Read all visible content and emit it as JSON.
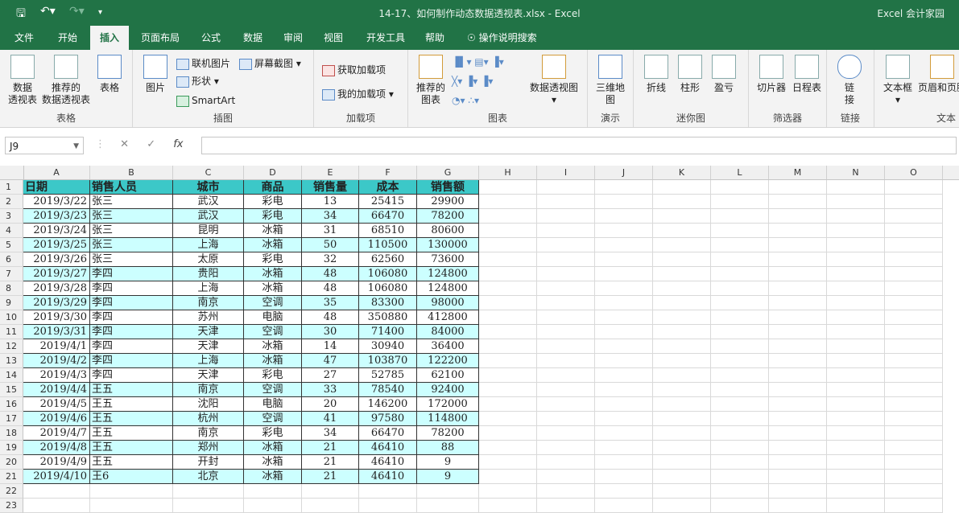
{
  "window": {
    "title": "14-17、如何制作动态数据透视表.xlsx  -  Excel",
    "account": "Excel 会计家园"
  },
  "tabs": [
    "文件",
    "开始",
    "插入",
    "页面布局",
    "公式",
    "数据",
    "审阅",
    "视图",
    "开发工具",
    "帮助"
  ],
  "tell_me": "操作说明搜索",
  "ribbon": {
    "groups": {
      "tables": "表格",
      "illustrations": "插图",
      "addins": "加载项",
      "charts": "图表",
      "tours": "演示",
      "sparklines": "迷你图",
      "filters": "筛选器",
      "links": "链接",
      "text": "文本"
    },
    "buttons": {
      "pivot1": "数据",
      "pivot2": "透视表",
      "rec_pivot1": "推荐的",
      "rec_pivot2": "数据透视表",
      "table": "表格",
      "picture": "图片",
      "online_pic": "联机图片",
      "shapes": "形状",
      "smartart": "SmartArt",
      "screenshot": "屏幕截图",
      "get_addins": "获取加载项",
      "my_addins": "我的加载项",
      "rec_chart1": "推荐的",
      "rec_chart2": "图表",
      "pivot_chart": "数据透视图",
      "map1": "三维地",
      "map2": "图",
      "spark_line": "折线",
      "spark_col": "柱形",
      "spark_wl": "盈亏",
      "slicer": "切片器",
      "timeline": "日程表",
      "link1": "链",
      "link2": "接",
      "textbox": "文本框",
      "header_footer": "页眉和页脚"
    }
  },
  "formula_bar": {
    "name_box": "J9",
    "fx": "fx",
    "value": ""
  },
  "columns": [
    "A",
    "B",
    "C",
    "D",
    "E",
    "F",
    "G",
    "H",
    "I",
    "J",
    "K",
    "L",
    "M",
    "N",
    "O"
  ],
  "row_numbers": [
    "1",
    "2",
    "3",
    "4",
    "5",
    "6",
    "7",
    "8",
    "9",
    "10",
    "11",
    "12",
    "13",
    "14",
    "15",
    "16",
    "17",
    "18",
    "19",
    "20",
    "21",
    "22",
    "23"
  ],
  "table": {
    "headers": [
      "日期",
      "销售人员",
      "城市",
      "商品",
      "销售量",
      "成本",
      "销售额"
    ],
    "rows": [
      [
        "2019/3/22",
        "张三",
        "武汉",
        "彩电",
        "13",
        "25415",
        "29900"
      ],
      [
        "2019/3/23",
        "张三",
        "武汉",
        "彩电",
        "34",
        "66470",
        "78200"
      ],
      [
        "2019/3/24",
        "张三",
        "昆明",
        "冰箱",
        "31",
        "68510",
        "80600"
      ],
      [
        "2019/3/25",
        "张三",
        "上海",
        "冰箱",
        "50",
        "110500",
        "130000"
      ],
      [
        "2019/3/26",
        "张三",
        "太原",
        "彩电",
        "32",
        "62560",
        "73600"
      ],
      [
        "2019/3/27",
        "李四",
        "贵阳",
        "冰箱",
        "48",
        "106080",
        "124800"
      ],
      [
        "2019/3/28",
        "李四",
        "上海",
        "冰箱",
        "48",
        "106080",
        "124800"
      ],
      [
        "2019/3/29",
        "李四",
        "南京",
        "空调",
        "35",
        "83300",
        "98000"
      ],
      [
        "2019/3/30",
        "李四",
        "苏州",
        "电脑",
        "48",
        "350880",
        "412800"
      ],
      [
        "2019/3/31",
        "李四",
        "天津",
        "空调",
        "30",
        "71400",
        "84000"
      ],
      [
        "2019/4/1",
        "李四",
        "天津",
        "冰箱",
        "14",
        "30940",
        "36400"
      ],
      [
        "2019/4/2",
        "李四",
        "上海",
        "冰箱",
        "47",
        "103870",
        "122200"
      ],
      [
        "2019/4/3",
        "李四",
        "天津",
        "彩电",
        "27",
        "52785",
        "62100"
      ],
      [
        "2019/4/4",
        "王五",
        "南京",
        "空调",
        "33",
        "78540",
        "92400"
      ],
      [
        "2019/4/5",
        "王五",
        "沈阳",
        "电脑",
        "20",
        "146200",
        "172000"
      ],
      [
        "2019/4/6",
        "王五",
        "杭州",
        "空调",
        "41",
        "97580",
        "114800"
      ],
      [
        "2019/4/7",
        "王五",
        "南京",
        "彩电",
        "34",
        "66470",
        "78200"
      ],
      [
        "2019/4/8",
        "王五",
        "郑州",
        "冰箱",
        "21",
        "46410",
        "88"
      ],
      [
        "2019/4/9",
        "王五",
        "开封",
        "冰箱",
        "21",
        "46410",
        "9"
      ],
      [
        "2019/4/10",
        "王6",
        "北京",
        "冰箱",
        "21",
        "46410",
        "9"
      ]
    ]
  },
  "colors": {
    "header_fill": "#3cc8c8",
    "band_fill": "#ccffff",
    "accent": "#217346"
  }
}
